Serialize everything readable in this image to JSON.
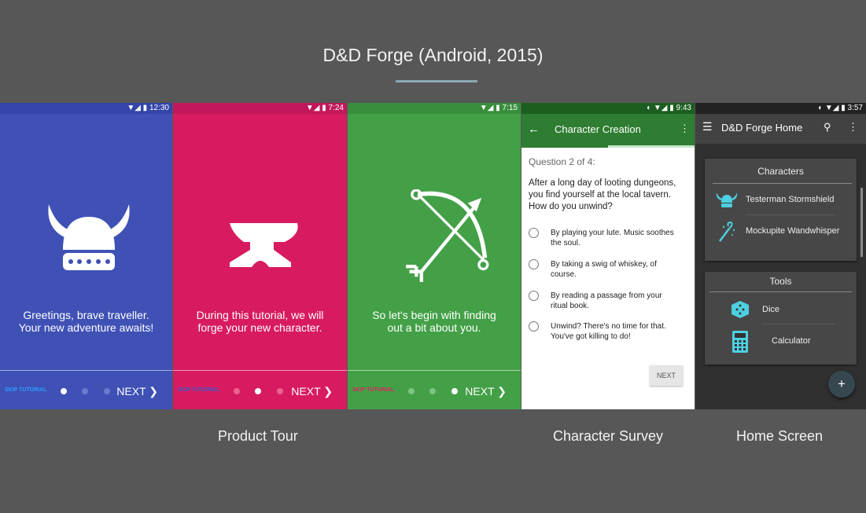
{
  "page": {
    "title": "D&D Forge (Android, 2015)"
  },
  "captions": {
    "product_tour": "Product Tour",
    "character_survey": "Character Survey",
    "home_screen": "Home Screen"
  },
  "tour": [
    {
      "time": "12:30",
      "text_line1": "Greetings, brave traveller.",
      "text_line2": "Your new adventure awaits!",
      "skip": "SKIP TUTORIAL",
      "next": "NEXT",
      "bg": "#3f51b5",
      "skip_color": "#2f9cff"
    },
    {
      "time": "7:24",
      "text_line1": "During this tutorial, we will",
      "text_line2": "forge your new character.",
      "skip": "SKIP TUTORIAL",
      "next": "NEXT",
      "bg": "#d81b60",
      "skip_color": "#3b5bc8"
    },
    {
      "time": "7:15",
      "text_line1": "So let's begin with finding",
      "text_line2": "out a bit about you.",
      "skip": "SKIP TUTORIAL",
      "next": "NEXT",
      "bg": "#43a047",
      "skip_color": "#e0245e"
    }
  ],
  "survey": {
    "time": "9:43",
    "appbar_title": "Character Creation",
    "question_counter": "Question 2 of 4:",
    "question": "After a long day of looting dungeons, you find yourself at the local tavern. How do you unwind?",
    "options": [
      "By playing your lute. Music soothes the soul.",
      "By taking a swig of whiskey, of course.",
      "By reading a passage from your ritual book.",
      "Unwind? There's no time for that. You've got killing to do!"
    ],
    "next_button": "NEXT",
    "accent": "#2e7d32"
  },
  "home": {
    "time": "3:57",
    "appbar_title": "D&D Forge Home",
    "characters_title": "Characters",
    "characters": [
      "Testerman Stormshield",
      "Mockupite Wandwhisper"
    ],
    "tools_title": "Tools",
    "tools": [
      "Dice",
      "Calculator"
    ],
    "fab": "+",
    "accent": "#4dd0e1"
  }
}
